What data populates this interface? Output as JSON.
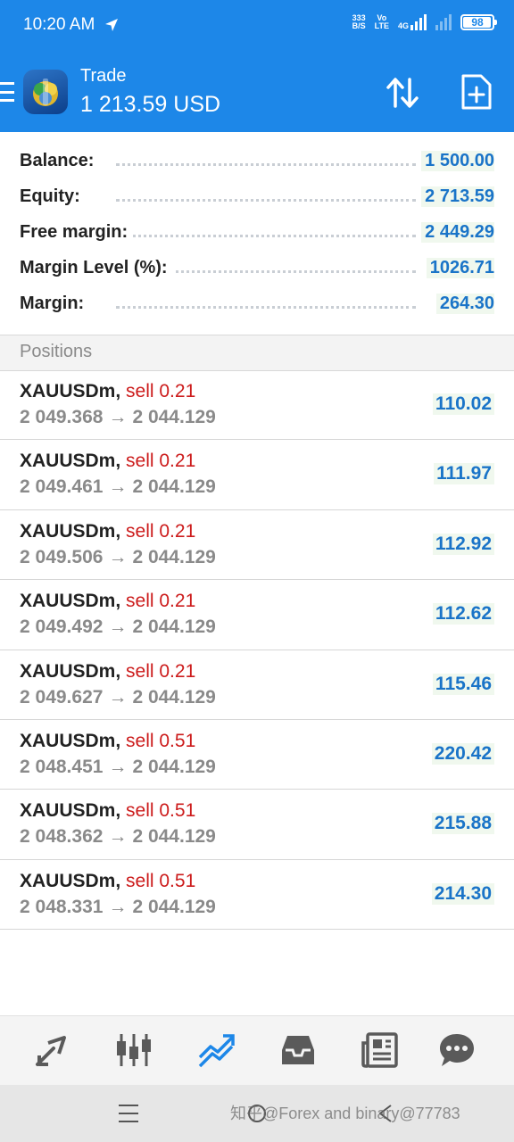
{
  "status_bar": {
    "time": "10:20 AM",
    "net_speed_value": "333",
    "net_speed_unit": "B/S",
    "volte_top": "Vo",
    "volte_bottom": "LTE",
    "network": "4G",
    "battery": "98",
    "battery_level": 0.98
  },
  "app_bar": {
    "title": "Trade",
    "balance": "1 213.59 USD",
    "icons": [
      "menu-icon",
      "app-logo",
      "sort-icon",
      "new-order-icon"
    ]
  },
  "summary": [
    {
      "label": "Balance:",
      "value": "1 500.00"
    },
    {
      "label": "Equity:",
      "value": "2 713.59"
    },
    {
      "label": "Free margin:",
      "value": "2 449.29"
    },
    {
      "label": "Margin Level (%):",
      "value": "1026.71"
    },
    {
      "label": "Margin:",
      "value": "264.30"
    }
  ],
  "positions_header": "Positions",
  "positions": [
    {
      "symbol": "XAUUSDm,",
      "side": "sell 0.21",
      "open_price": "2 049.368",
      "arrow": "→",
      "current_price": "2 044.129",
      "profit": "110.02"
    },
    {
      "symbol": "XAUUSDm,",
      "side": "sell 0.21",
      "open_price": "2 049.461",
      "arrow": "→",
      "current_price": "2 044.129",
      "profit": "111.97"
    },
    {
      "symbol": "XAUUSDm,",
      "side": "sell 0.21",
      "open_price": "2 049.506",
      "arrow": "→",
      "current_price": "2 044.129",
      "profit": "112.92"
    },
    {
      "symbol": "XAUUSDm,",
      "side": "sell 0.21",
      "open_price": "2 049.492",
      "arrow": "→",
      "current_price": "2 044.129",
      "profit": "112.62"
    },
    {
      "symbol": "XAUUSDm,",
      "side": "sell 0.21",
      "open_price": "2 049.627",
      "arrow": "→",
      "current_price": "2 044.129",
      "profit": "115.46"
    },
    {
      "symbol": "XAUUSDm,",
      "side": "sell 0.51",
      "open_price": "2 048.451",
      "arrow": "→",
      "current_price": "2 044.129",
      "profit": "220.42"
    },
    {
      "symbol": "XAUUSDm,",
      "side": "sell 0.51",
      "open_price": "2 048.362",
      "arrow": "→",
      "current_price": "2 044.129",
      "profit": "215.88"
    },
    {
      "symbol": "XAUUSDm,",
      "side": "sell 0.51",
      "open_price": "2 048.331",
      "arrow": "→",
      "current_price": "2 044.129",
      "profit": "214.30"
    }
  ],
  "bottom_nav": [
    {
      "name": "quotes-icon",
      "active": false
    },
    {
      "name": "chart-icon",
      "active": false
    },
    {
      "name": "trade-icon",
      "active": true
    },
    {
      "name": "history-icon",
      "active": false
    },
    {
      "name": "news-icon",
      "active": false
    },
    {
      "name": "messages-icon",
      "active": false
    }
  ],
  "watermark": "知乎@Forex and binary@77783",
  "colors": {
    "primary": "#1d87e8",
    "profit": "#1a74c8",
    "sell": "#cc1b1b",
    "active_nav": "#1d87e8",
    "inactive_nav": "#5a5a5a"
  }
}
